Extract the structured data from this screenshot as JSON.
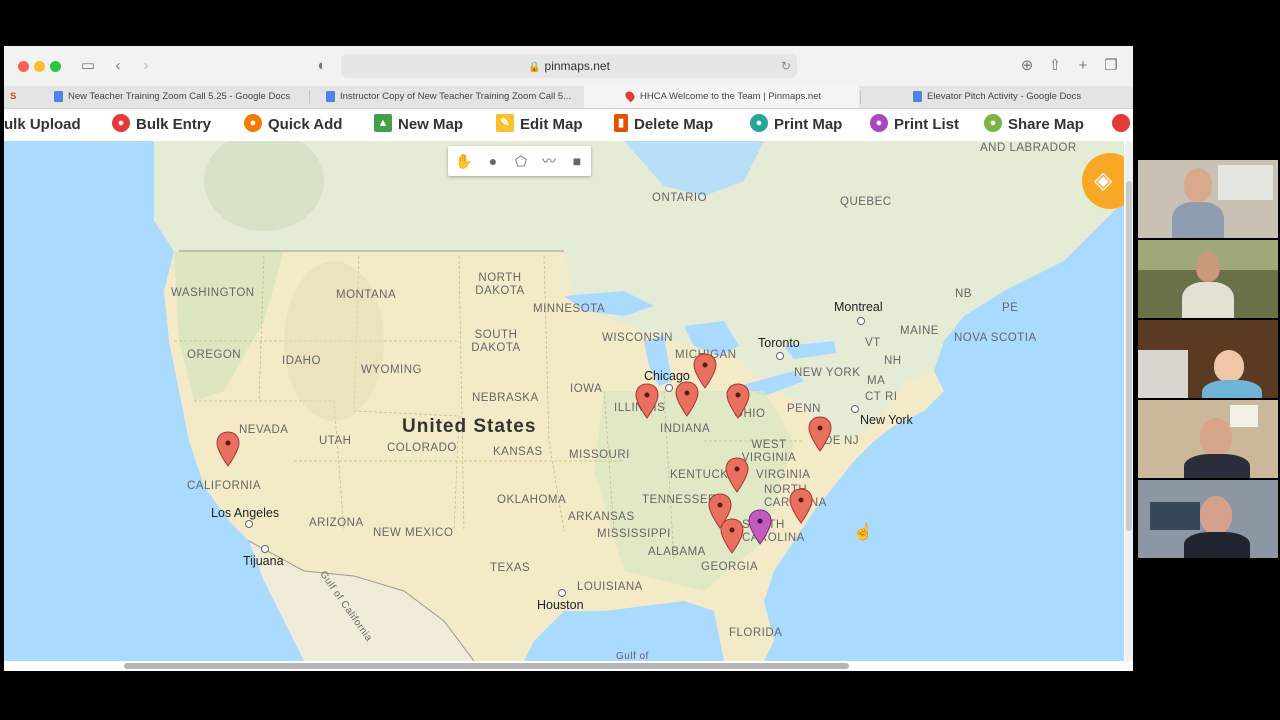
{
  "browser": {
    "url": "pinmaps.net",
    "tabs": [
      {
        "label": "New Teacher Training Zoom Call 5.25 - Google Docs",
        "active": false
      },
      {
        "label": "Instructor Copy of New Teacher Training Zoom Call 5...",
        "active": false
      },
      {
        "label": "HHCA Welcome to the Team | Pinmaps.net",
        "active": true
      },
      {
        "label": "Elevator Pitch Activity - Google Docs",
        "active": false
      }
    ]
  },
  "toolbar": {
    "items": [
      {
        "label": "ulk Upload",
        "color": "#444"
      },
      {
        "label": "Bulk Entry",
        "color": "#e53935"
      },
      {
        "label": "Quick Add",
        "color": "#f57c00"
      },
      {
        "label": "New Map",
        "color": "#43a047"
      },
      {
        "label": "Edit Map",
        "color": "#fbc02d"
      },
      {
        "label": "Delete Map",
        "color": "#e65100"
      },
      {
        "label": "Print Map",
        "color": "#26a69a"
      },
      {
        "label": "Print List",
        "color": "#ab47bc"
      },
      {
        "label": "Share Map",
        "color": "#7cb342"
      }
    ]
  },
  "map": {
    "country_label": "United States",
    "region_labels": [
      "ONTARIO",
      "QUEBEC",
      "AND LABRADOR",
      "WASHINGTON",
      "MONTANA",
      "NORTH DAKOTA",
      "MINNESOTA",
      "OREGON",
      "IDAHO",
      "SOUTH DAKOTA",
      "WISCONSIN",
      "MICHIGAN",
      "WYOMING",
      "IOWA",
      "NEBRASKA",
      "ILLINOIS",
      "INDIANA",
      "OHIO",
      "NEVADA",
      "UTAH",
      "COLORADO",
      "KANSAS",
      "MISSOURI",
      "KENTUCKY",
      "WEST VIRGINIA",
      "VIRGINIA",
      "PENN",
      "CALIFORNIA",
      "OKLAHOMA",
      "TENNESSEE",
      "NORTH CAROLINA",
      "ARIZONA",
      "NEW MEXICO",
      "ARKANSAS",
      "MISSISSIPPI",
      "ALABAMA",
      "SOUTH CAROLINA",
      "GEORGIA",
      "TEXAS",
      "LOUISIANA",
      "FLORIDA",
      "NEW YORK",
      "VT",
      "NH",
      "MA",
      "CT",
      "RI",
      "NJ",
      "DE",
      "MAINE",
      "NB",
      "PE",
      "NOVA SCOTIA",
      "Gulf of California",
      "Gulf of"
    ],
    "cities": [
      "Montreal",
      "Toronto",
      "Chicago",
      "New York",
      "Los Angeles",
      "Tijuana",
      "Houston"
    ],
    "pins": {
      "count": 11,
      "red_color": "#e8705f",
      "purple_color": "#c35bbf"
    }
  },
  "icons": {
    "drawing_tools": [
      "hand-icon",
      "circle-icon",
      "polygon-icon",
      "polyline-icon",
      "rectangle-icon"
    ],
    "layers": "layers-icon"
  },
  "participants": 5
}
